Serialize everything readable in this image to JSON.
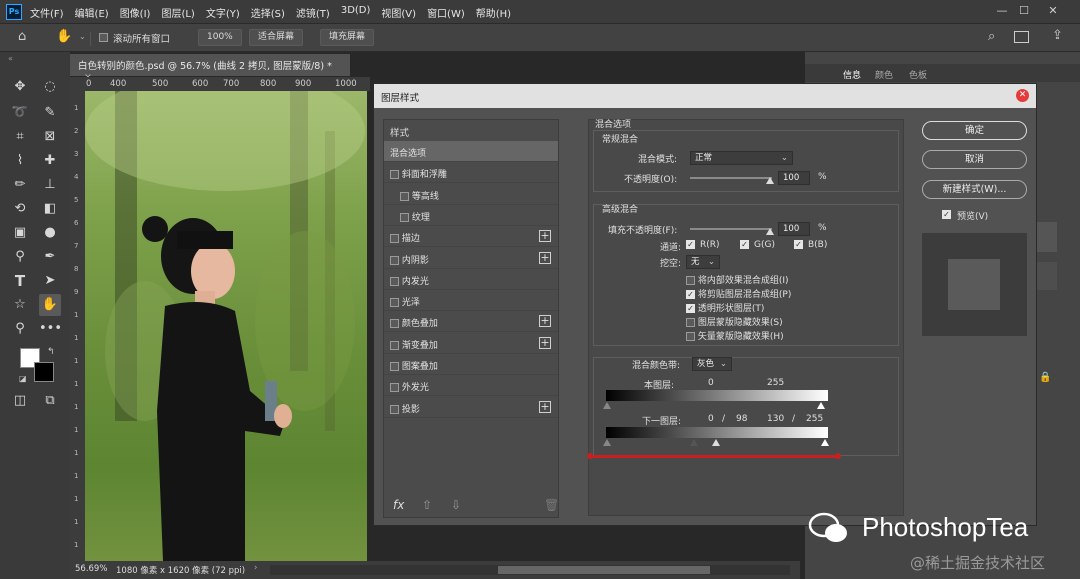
{
  "menubar": {
    "logo": "Ps",
    "items": [
      "文件(F)",
      "编辑(E)",
      "图像(I)",
      "图层(L)",
      "文字(Y)",
      "选择(S)",
      "滤镜(T)",
      "3D(D)",
      "视图(V)",
      "窗口(W)",
      "帮助(H)"
    ],
    "min": "—",
    "max": "☐",
    "close": "✕"
  },
  "options": {
    "scroll_all": "滚动所有窗口",
    "zoom": "100%",
    "fit": "适合屏幕",
    "fill": "填充屏幕"
  },
  "document": {
    "tab_title": "白色转别的颜色.psd @ 56.7% (曲线 2 拷贝, 图层蒙版/8) *",
    "tab_close": "×",
    "ruler_ticks": [
      "0",
      "400",
      "500",
      "600",
      "700",
      "800",
      "900",
      "1000"
    ],
    "left_ticks": [
      "1",
      "2",
      "3",
      "4",
      "5",
      "6",
      "7",
      "8",
      "9",
      "1",
      "1",
      "1",
      "1",
      "1",
      "1",
      "1",
      "1",
      "1",
      "1",
      "1"
    ]
  },
  "status": {
    "zoom": "56.69%",
    "info": "1080 像素 x 1620 像素 (72 ppi)",
    "arrow": "›"
  },
  "right_panel": {
    "tabs": [
      "信息",
      "颜色",
      "色板"
    ]
  },
  "dialog": {
    "title": "图层样式",
    "close": "✕",
    "styles_header": "样式",
    "style_items": [
      {
        "label": "混合选项",
        "checkbox": false,
        "plus": false,
        "indent": false,
        "selected": true
      },
      {
        "label": "斜面和浮雕",
        "checkbox": true,
        "plus": false,
        "indent": false,
        "selected": false
      },
      {
        "label": "等高线",
        "checkbox": true,
        "plus": false,
        "indent": true,
        "selected": false
      },
      {
        "label": "纹理",
        "checkbox": true,
        "plus": false,
        "indent": true,
        "selected": false
      },
      {
        "label": "描边",
        "checkbox": true,
        "plus": true,
        "indent": false,
        "selected": false
      },
      {
        "label": "内阴影",
        "checkbox": true,
        "plus": true,
        "indent": false,
        "selected": false
      },
      {
        "label": "内发光",
        "checkbox": true,
        "plus": false,
        "indent": false,
        "selected": false
      },
      {
        "label": "光泽",
        "checkbox": true,
        "plus": false,
        "indent": false,
        "selected": false
      },
      {
        "label": "颜色叠加",
        "checkbox": true,
        "plus": true,
        "indent": false,
        "selected": false
      },
      {
        "label": "渐变叠加",
        "checkbox": true,
        "plus": true,
        "indent": false,
        "selected": false
      },
      {
        "label": "图案叠加",
        "checkbox": true,
        "plus": false,
        "indent": false,
        "selected": false
      },
      {
        "label": "外发光",
        "checkbox": true,
        "plus": false,
        "indent": false,
        "selected": false
      },
      {
        "label": "投影",
        "checkbox": true,
        "plus": true,
        "indent": false,
        "selected": false
      }
    ],
    "fx": "fx",
    "blend_options": {
      "title": "混合选项",
      "general": "常规混合",
      "mode_label": "混合模式:",
      "mode_value": "正常",
      "opacity_label": "不透明度(O):",
      "opacity_value": "100",
      "percent": "%",
      "advanced": "高级混合",
      "fill_label": "填充不透明度(F):",
      "fill_value": "100",
      "channels_label": "通道:",
      "ch_r": "R(R)",
      "ch_g": "G(G)",
      "ch_b": "B(B)",
      "knockout_label": "挖空:",
      "knockout_value": "无",
      "options": [
        {
          "label": "将内部效果混合成组(I)",
          "checked": false
        },
        {
          "label": "将剪贴图层混合成组(P)",
          "checked": true
        },
        {
          "label": "透明形状图层(T)",
          "checked": true
        },
        {
          "label": "图层蒙版隐藏效果(S)",
          "checked": false
        },
        {
          "label": "矢量蒙版隐藏效果(H)",
          "checked": false
        }
      ],
      "blend_if_label": "混合颜色带:",
      "blend_if_value": "灰色",
      "this_layer_label": "本图层:",
      "this_layer_values": [
        "0",
        "255"
      ],
      "under_layer_label": "下一图层:",
      "under_layer_values": [
        "0",
        "/",
        "98",
        "130",
        "/",
        "255"
      ]
    },
    "buttons": {
      "ok": "确定",
      "cancel": "取消",
      "new_style": "新建样式(W)...",
      "preview": "预览(V)"
    }
  },
  "watermark": {
    "brand": "PhotoshopTea",
    "site": "@稀土掘金技术社区"
  },
  "colors": {
    "accent_red": "#c8201e",
    "dialog_bg": "#525252"
  }
}
